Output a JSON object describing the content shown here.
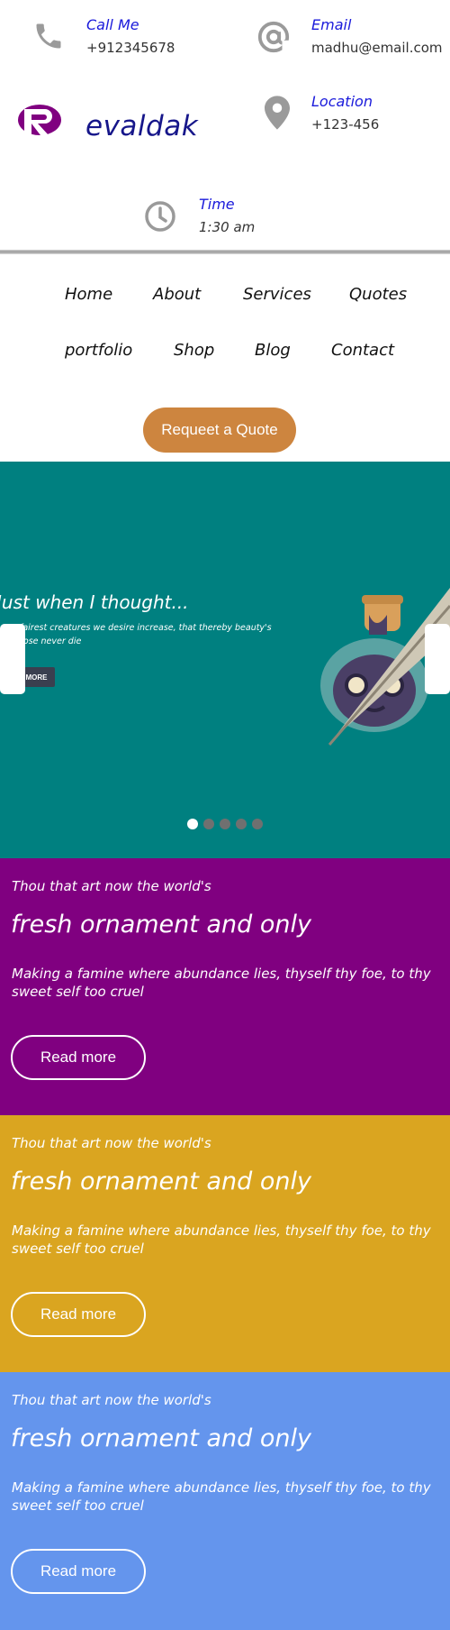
{
  "contact": {
    "call": {
      "label": "Call Me",
      "value": "+912345678",
      "icon": "phone-icon"
    },
    "email": {
      "label": "Email",
      "value": "madhu@email.com",
      "icon": "at-sign-icon"
    },
    "location": {
      "label": "Location",
      "value": "+123-456",
      "icon": "map-pin-icon"
    },
    "time": {
      "label": "Time",
      "value": "1:30 am",
      "icon": "clock-icon"
    }
  },
  "brand": {
    "name": "evaldak",
    "logo_color": "#800080"
  },
  "nav": {
    "items": [
      "Home",
      "About",
      "Services",
      "Quotes",
      "portfolio",
      "Shop",
      "Blog",
      "Contact"
    ]
  },
  "cta": {
    "label": "Requeet a Quote",
    "color": "#cd853f"
  },
  "hero": {
    "title": "Just when I thought...",
    "text": "fairest creatures we desire increase, that thereby beauty's rose never die",
    "button": "MORE",
    "background": "#008080",
    "dot_count": 5,
    "active_dot": 1
  },
  "promos": [
    {
      "kicker": "Thou that art now the world's",
      "headline": "fresh ornament and only",
      "body": "Making a famine where abundance lies, thyself thy foe, to thy sweet self too cruel",
      "button": "Read more",
      "color": "#800080"
    },
    {
      "kicker": "Thou that art now the world's",
      "headline": "fresh ornament and only",
      "body": "Making a famine where abundance lies, thyself thy foe, to thy sweet self too cruel",
      "button": "Read more",
      "color": "#daa520"
    },
    {
      "kicker": "Thou that art now the world's",
      "headline": "fresh ornament and only",
      "body": "Making a famine where abundance lies, thyself thy foe, to thy sweet self too cruel",
      "button": "Read more",
      "color": "#6495ed"
    }
  ]
}
